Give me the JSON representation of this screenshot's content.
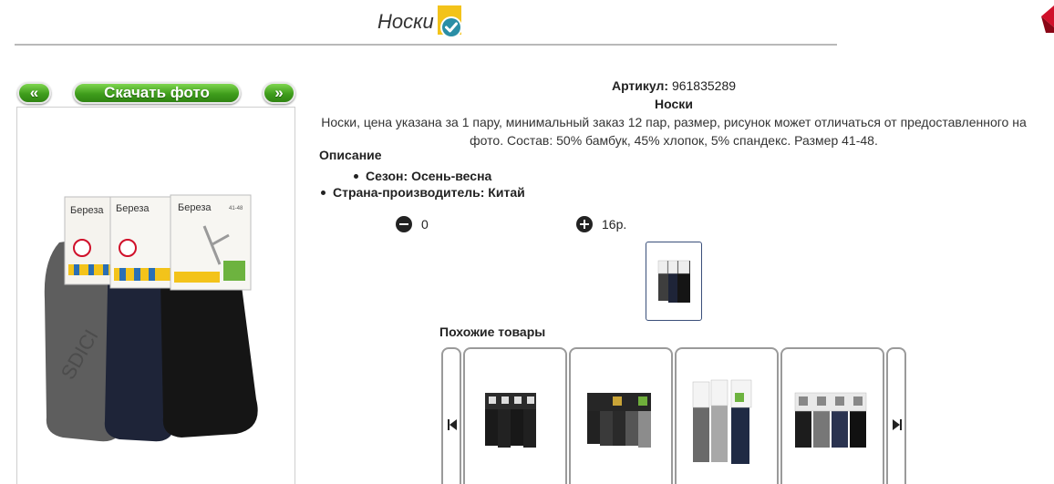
{
  "header": {
    "title": "Носки",
    "verified_icon": "check-badge-icon",
    "corner_icon": "red-arrow-icon"
  },
  "gallery": {
    "prev_label": "«",
    "download_label": "Скачать фото",
    "next_label": "»",
    "pack_brand": "Береза",
    "pack_size": "41-48"
  },
  "product": {
    "articul_label": "Артикул:",
    "articul_value": "961835289",
    "name": "Носки",
    "description": "Носки, цена указана за 1 пару, минимальный заказ 12 пар, размер, рисунок может отличаться от предоставленного на фото. Состав: 50% бамбук, 45% хлопок, 5% спандекс. Размер 41-48."
  },
  "specs": {
    "heading": "Описание",
    "items": [
      "Сезон: Осень-весна",
      "Страна-производитель: Китай"
    ]
  },
  "order": {
    "quantity": "0",
    "price": "16р.",
    "minus_icon": "minus-circle-icon",
    "plus_icon": "plus-circle-icon"
  },
  "similar": {
    "heading": "Похожие товары",
    "prev_icon": "skip-back-icon",
    "next_icon": "skip-forward-icon",
    "item_count": 4
  },
  "colors": {
    "button_green": "#3f9d1c",
    "accent_red": "#d0102a",
    "badge_yellow": "#f3c31a",
    "badge_teal": "#2a8ea6"
  }
}
